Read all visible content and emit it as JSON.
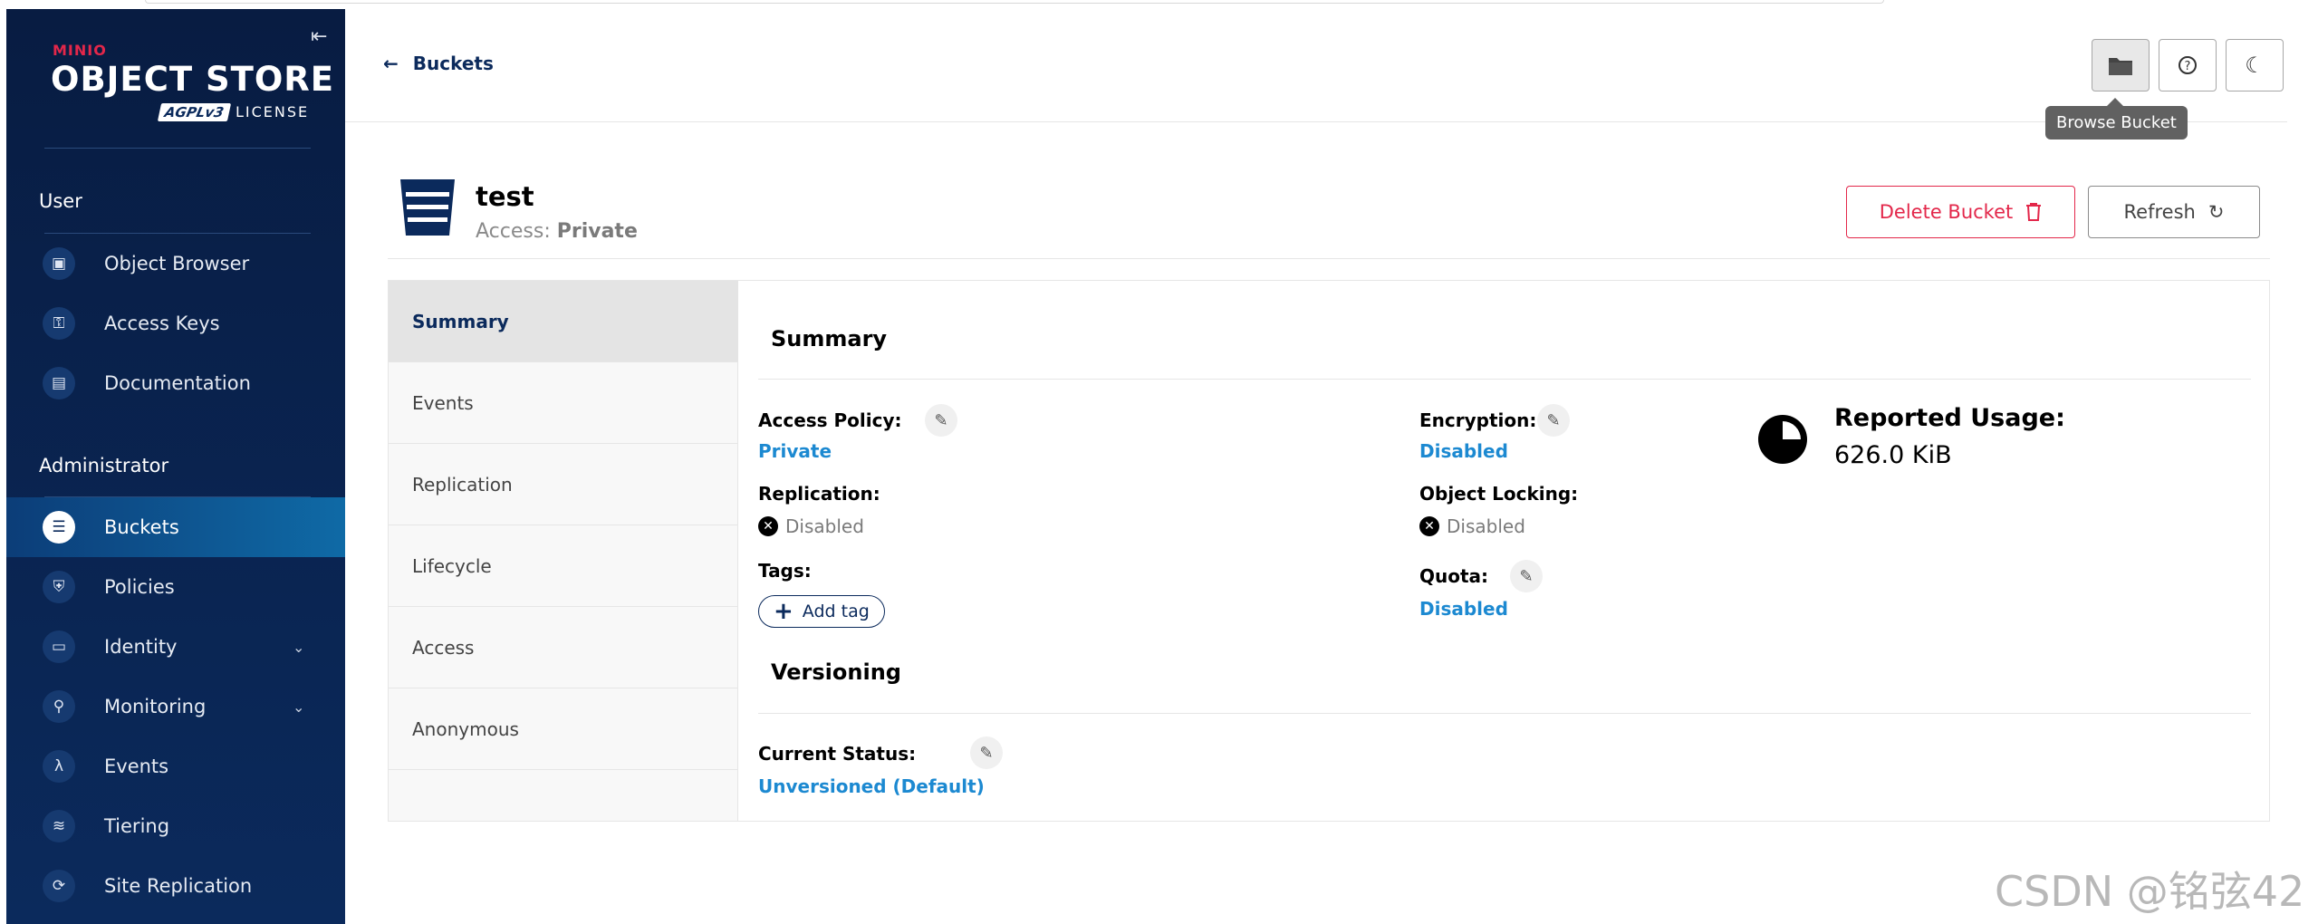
{
  "sidebar": {
    "brand_minio": "MINIO",
    "brand_store": "OBJECT STORE",
    "brand_agpl": "AGPLv3",
    "brand_license": "LICENSE",
    "section_user": "User",
    "user_items": [
      {
        "label": "Object Browser",
        "icon": "object-browser-icon"
      },
      {
        "label": "Access Keys",
        "icon": "access-keys-icon"
      },
      {
        "label": "Documentation",
        "icon": "documentation-icon"
      }
    ],
    "section_admin": "Administrator",
    "admin_items": [
      {
        "label": "Buckets",
        "icon": "bucket-icon",
        "active": true
      },
      {
        "label": "Policies",
        "icon": "shield-icon"
      },
      {
        "label": "Identity",
        "icon": "id-card-icon",
        "expandable": true
      },
      {
        "label": "Monitoring",
        "icon": "magnifier-icon",
        "expandable": true
      },
      {
        "label": "Events",
        "icon": "lambda-icon"
      },
      {
        "label": "Tiering",
        "icon": "layers-icon"
      },
      {
        "label": "Site Replication",
        "icon": "sync-icon"
      }
    ]
  },
  "topbar": {
    "back_label": "Buckets",
    "tooltip": "Browse Bucket"
  },
  "bucket": {
    "name": "test",
    "access_label": "Access:",
    "access_value": "Private"
  },
  "actions": {
    "delete_label": "Delete Bucket",
    "refresh_label": "Refresh"
  },
  "tabs": [
    "Summary",
    "Events",
    "Replication",
    "Lifecycle",
    "Access",
    "Anonymous"
  ],
  "summary": {
    "title": "Summary",
    "access_policy_label": "Access Policy:",
    "access_policy_value": "Private",
    "replication_label": "Replication:",
    "replication_value": "Disabled",
    "tags_label": "Tags:",
    "add_tag_label": "Add tag",
    "encryption_label": "Encryption:",
    "encryption_value": "Disabled",
    "object_locking_label": "Object Locking:",
    "object_locking_value": "Disabled",
    "quota_label": "Quota:",
    "quota_value": "Disabled",
    "usage_title": "Reported Usage:",
    "usage_value": "626.0 KiB"
  },
  "versioning": {
    "title": "Versioning",
    "status_label": "Current Status:",
    "status_value": "Unversioned (Default)"
  },
  "watermark": "CSDN @铭弦42",
  "colors": {
    "sidebar_bg": "#0b2a5c",
    "accent_link": "#1c89d1",
    "danger": "#e3274a"
  }
}
